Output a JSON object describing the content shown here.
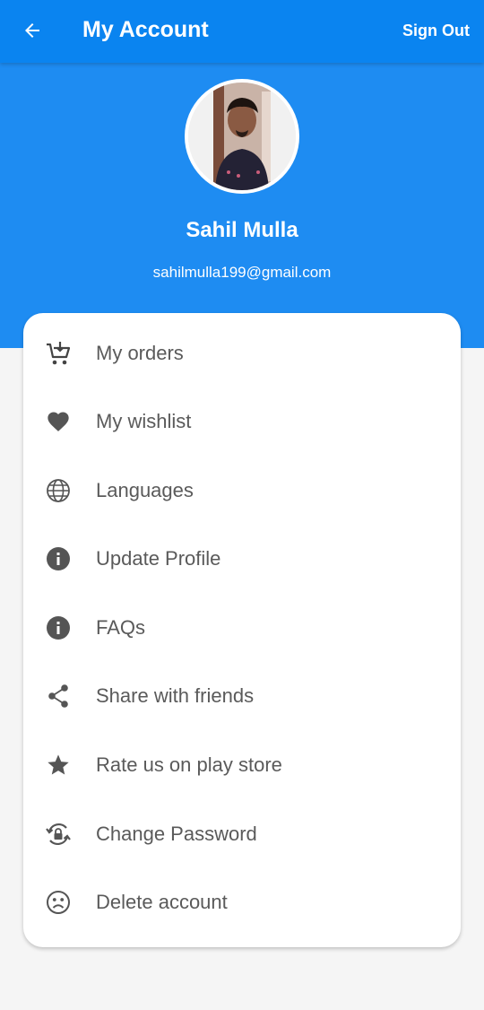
{
  "appbar": {
    "title": "My Account",
    "back_icon": "arrow-left-icon",
    "sign_out_label": "Sign Out",
    "color": "#0a84f0"
  },
  "profile": {
    "name": "Sahil Mulla",
    "email": "sahilmulla199@gmail.com",
    "hero_color": "#1e8cf2"
  },
  "menu": {
    "items": [
      {
        "label": "My orders",
        "icon": "cart-download-icon"
      },
      {
        "label": "My wishlist",
        "icon": "heart-icon"
      },
      {
        "label": "Languages",
        "icon": "globe-icon"
      },
      {
        "label": "Update Profile",
        "icon": "info-icon"
      },
      {
        "label": "FAQs",
        "icon": "info-icon"
      },
      {
        "label": "Share with friends",
        "icon": "share-icon"
      },
      {
        "label": "Rate us on play store",
        "icon": "star-icon"
      },
      {
        "label": "Change Password",
        "icon": "lock-reset-icon"
      },
      {
        "label": "Delete account",
        "icon": "sad-face-icon"
      }
    ]
  }
}
